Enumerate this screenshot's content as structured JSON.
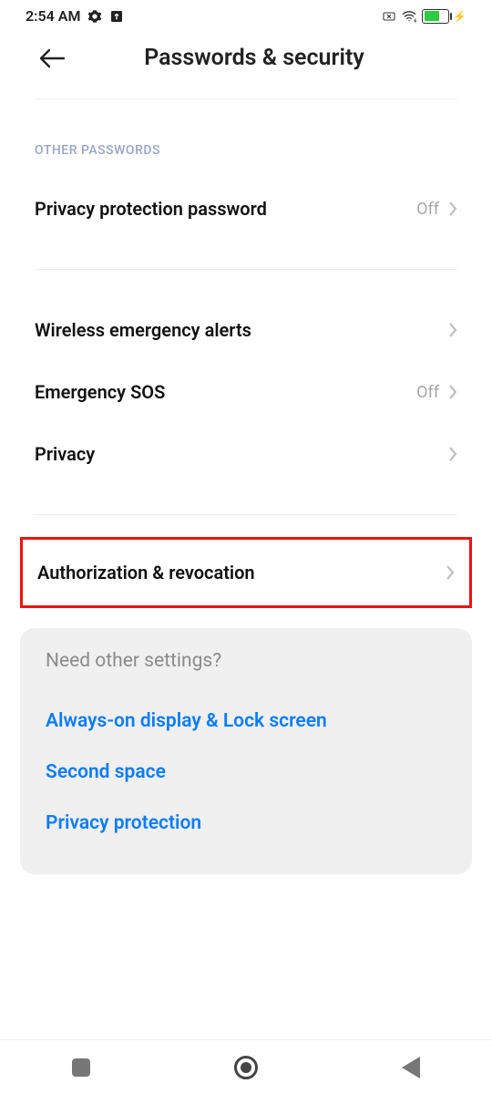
{
  "statusbar": {
    "time": "2:54 AM",
    "battery": "53"
  },
  "header": {
    "title": "Passwords & security"
  },
  "section_head": "OTHER PASSWORDS",
  "rows": {
    "privacy_pw": {
      "label": "Privacy protection password",
      "value": "Off"
    },
    "wea": {
      "label": "Wireless emergency alerts"
    },
    "esos": {
      "label": "Emergency SOS",
      "value": "Off"
    },
    "privacy": {
      "label": "Privacy"
    },
    "auth_rev": {
      "label": "Authorization & revocation"
    }
  },
  "card": {
    "prompt": "Need other settings?",
    "links": {
      "aod": "Always-on display & Lock screen",
      "second": "Second space",
      "priv": "Privacy protection"
    }
  }
}
